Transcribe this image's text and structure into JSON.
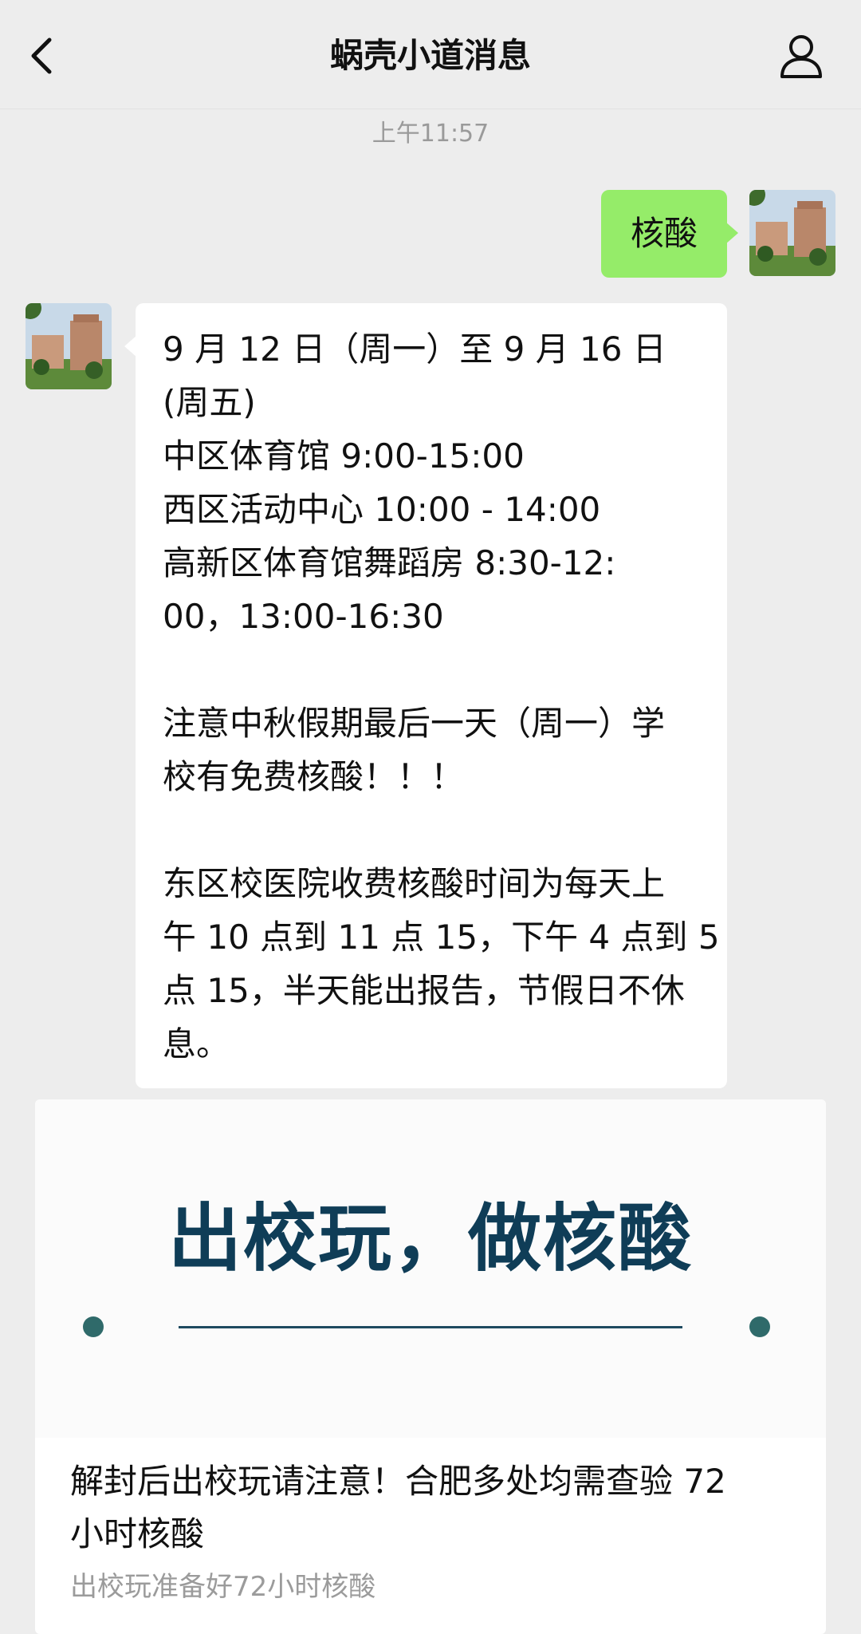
{
  "nav": {
    "title": "蜗壳小道消息"
  },
  "chat": {
    "time": "上午11:57",
    "sent_message": "核酸",
    "received_lines": [
      "9 月 12 日（周一）至 9 月 16 日",
      "(周五)",
      "中区体育馆 9:00-15:00",
      "西区活动中心 10:00 - 14:00",
      "高新区体育馆舞蹈房 8:30-12:",
      "00，13:00-16:30",
      "",
      "注意中秋假期最后一天（周一）学",
      "校有免费核酸！！！",
      "",
      "东区校医院收费核酸时间为每天上",
      "午 10 点到 11 点 15，下午 4 点到 5",
      "点 15，半天能出报告，节假日不休",
      "息。"
    ]
  },
  "card": {
    "cover_headline": "出校玩，做核酸",
    "title_lines": [
      "解封后出校玩请注意！合肥多处均需查验 72",
      "小时核酸"
    ],
    "subtitle": "出校玩准备好72小时核酸"
  },
  "icons": {
    "back": "chevron-left-icon",
    "profile": "person-icon"
  },
  "colors": {
    "background": "#ededed",
    "sent_bubble": "#95ec69",
    "received_bubble": "#ffffff",
    "cover_headline": "#0f3d57"
  }
}
